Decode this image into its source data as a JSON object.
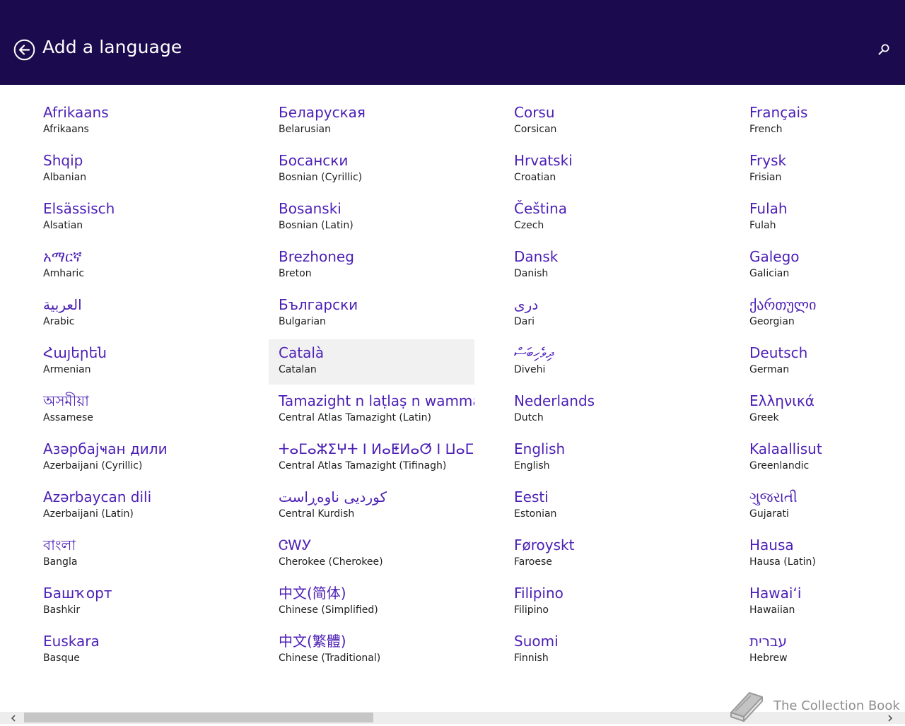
{
  "header": {
    "title": "Add a language",
    "back_icon": "back-arrow-circle-icon",
    "search_icon": "search-icon",
    "background_color": "#1b0a4d"
  },
  "languages": {
    "columns": [
      [
        {
          "native": "Afrikaans",
          "english": "Afrikaans"
        },
        {
          "native": "Shqip",
          "english": "Albanian"
        },
        {
          "native": "Elsässisch",
          "english": "Alsatian"
        },
        {
          "native": "አማርኛ",
          "english": "Amharic"
        },
        {
          "native": "العربية",
          "english": "Arabic"
        },
        {
          "native": "Հայերեն",
          "english": "Armenian"
        },
        {
          "native": "অসমীয়া",
          "english": "Assamese"
        },
        {
          "native": "Азәрбајҹан дили",
          "english": "Azerbaijani (Cyrillic)"
        },
        {
          "native": "Azərbaycan dili",
          "english": "Azerbaijani (Latin)"
        },
        {
          "native": "বাংলা",
          "english": "Bangla"
        },
        {
          "native": "Башҡорт",
          "english": "Bashkir"
        },
        {
          "native": "Euskara",
          "english": "Basque"
        }
      ],
      [
        {
          "native": "Беларуская",
          "english": "Belarusian"
        },
        {
          "native": "Босански",
          "english": "Bosnian (Cyrillic)"
        },
        {
          "native": "Bosanski",
          "english": "Bosnian (Latin)"
        },
        {
          "native": "Brezhoneg",
          "english": "Breton"
        },
        {
          "native": "Български",
          "english": "Bulgarian"
        },
        {
          "native": "Català",
          "english": "Catalan",
          "selected": true
        },
        {
          "native": "Tamazight n laṭlaṣ n wammas",
          "english": "Central Atlas Tamazight (Latin)"
        },
        {
          "native": "ⵜⴰⵎⴰⵣⵉⵖⵜ ⵏ ⵍⴰⵟⵍⴰⵚ ⵏ ⵡⴰⵎⵎⴰⵙ",
          "english": "Central Atlas Tamazight (Tifinagh)"
        },
        {
          "native": "کوردیی ناوەڕاست",
          "english": "Central Kurdish"
        },
        {
          "native": "ᏣᎳᎩ",
          "english": "Cherokee (Cherokee)"
        },
        {
          "native": "中文(简体)",
          "english": "Chinese (Simplified)"
        },
        {
          "native": "中文(繁體)",
          "english": "Chinese (Traditional)"
        }
      ],
      [
        {
          "native": "Corsu",
          "english": "Corsican"
        },
        {
          "native": "Hrvatski",
          "english": "Croatian"
        },
        {
          "native": "Čeština",
          "english": "Czech"
        },
        {
          "native": "Dansk",
          "english": "Danish"
        },
        {
          "native": "درى",
          "english": "Dari"
        },
        {
          "native": "ދިވެހިބަސް",
          "english": "Divehi"
        },
        {
          "native": "Nederlands",
          "english": "Dutch"
        },
        {
          "native": "English",
          "english": "English"
        },
        {
          "native": "Eesti",
          "english": "Estonian"
        },
        {
          "native": "Føroyskt",
          "english": "Faroese"
        },
        {
          "native": "Filipino",
          "english": "Filipino"
        },
        {
          "native": "Suomi",
          "english": "Finnish"
        }
      ],
      [
        {
          "native": "Français",
          "english": "French"
        },
        {
          "native": "Frysk",
          "english": "Frisian"
        },
        {
          "native": "Fulah",
          "english": "Fulah"
        },
        {
          "native": "Galego",
          "english": "Galician"
        },
        {
          "native": "ქართული",
          "english": "Georgian"
        },
        {
          "native": "Deutsch",
          "english": "German"
        },
        {
          "native": "Ελληνικά",
          "english": "Greek"
        },
        {
          "native": "Kalaallisut",
          "english": "Greenlandic"
        },
        {
          "native": "ગુજરાતી",
          "english": "Gujarati"
        },
        {
          "native": "Hausa",
          "english": "Hausa (Latin)"
        },
        {
          "native": "Hawaiʻi",
          "english": "Hawaiian"
        },
        {
          "native": "עברית",
          "english": "Hebrew"
        }
      ]
    ]
  },
  "scrollbar": {
    "left_icon": "chevron-left-icon",
    "right_icon": "chevron-right-icon",
    "position": 0.0
  },
  "watermark": {
    "text": "The Collection Book",
    "icon": "book-icon"
  },
  "colors": {
    "accent": "#4b1fb5",
    "header": "#1b0a4d",
    "selected_bg": "#f1f1f1"
  }
}
